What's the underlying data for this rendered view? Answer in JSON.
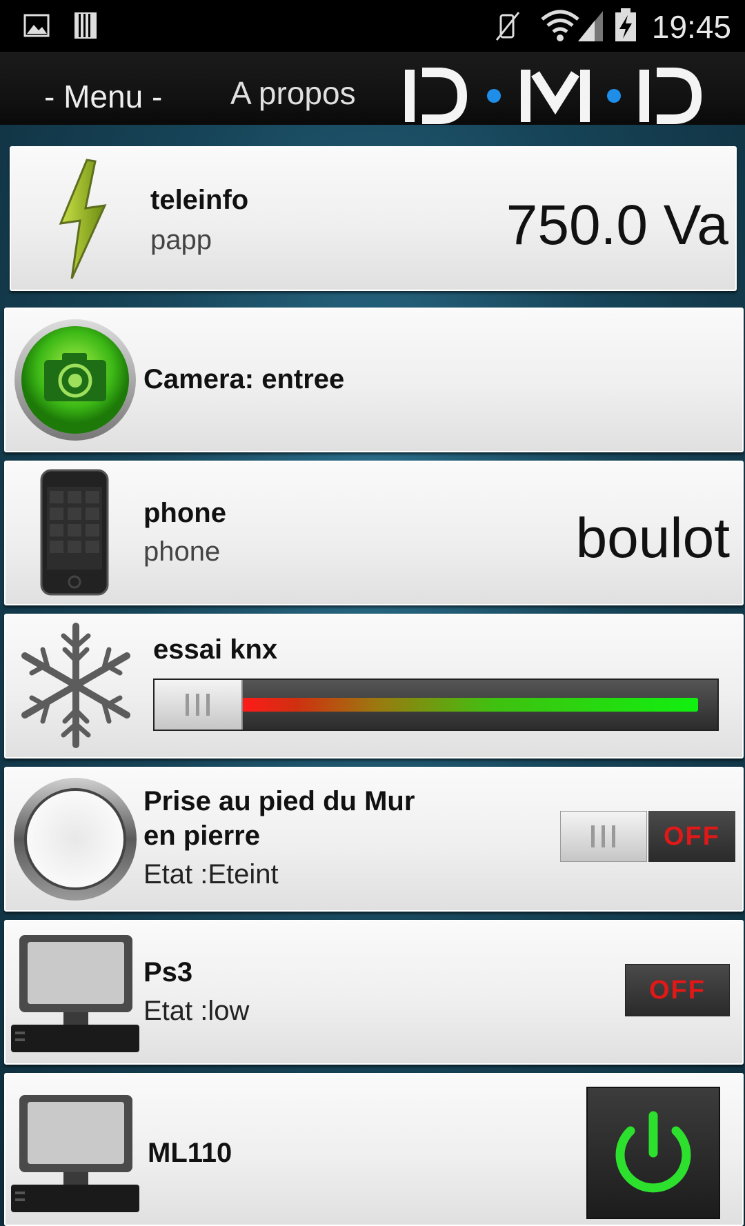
{
  "status_bar": {
    "time": "19:45",
    "icons": [
      "image-icon",
      "sd-card-icon",
      "vibrate-off-icon",
      "wifi-icon",
      "signal-icon",
      "battery-charging-icon"
    ]
  },
  "action_bar": {
    "menu_label": "- Menu -",
    "about_label": "A propos",
    "logo_text": "D·M·D"
  },
  "devices": {
    "teleinfo": {
      "title": "teleinfo",
      "subtitle": "papp",
      "value": "750.0 Va",
      "icon": "lightning-icon"
    },
    "camera": {
      "title": "Camera: entree",
      "icon": "camera-icon"
    },
    "phone": {
      "title": "phone",
      "subtitle": "phone",
      "value": "boulot",
      "icon": "phone-icon"
    },
    "knx": {
      "title": "essai knx",
      "icon": "snowflake-icon",
      "slider_level": 0.0,
      "colors": [
        "#e00000",
        "#00e000"
      ]
    },
    "prise": {
      "title_line1": "Prise au pied du Mur",
      "title_line2": "en pierre",
      "state": "Etat :Eteint",
      "toggle_label": "OFF",
      "icon": "outlet-icon"
    },
    "ps3": {
      "title": "Ps3",
      "state": "Etat :low",
      "toggle_label": "OFF",
      "icon": "computer-icon"
    },
    "ml110": {
      "title": "ML110",
      "icon": "computer-icon",
      "power_color": "#2ee02e"
    }
  }
}
